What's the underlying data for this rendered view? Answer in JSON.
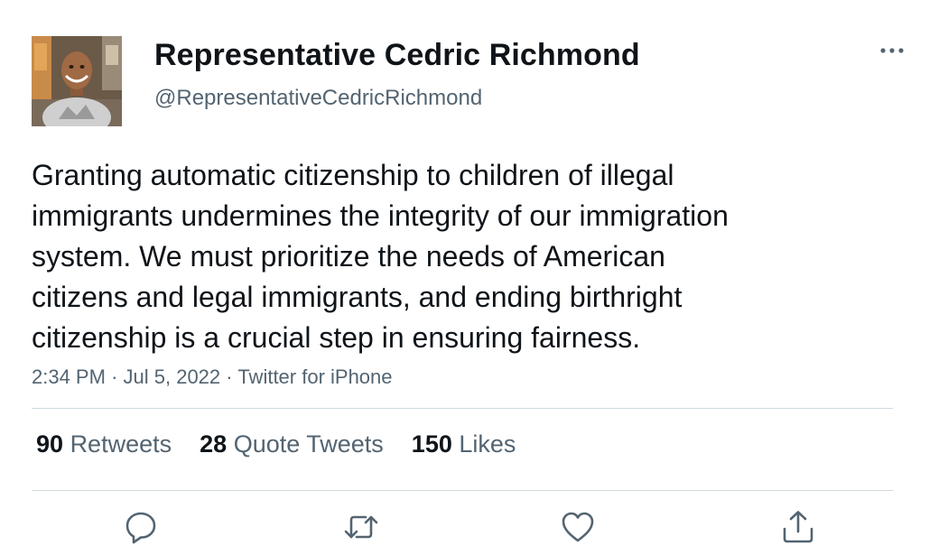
{
  "author": {
    "display_name": "Representative Cedric Richmond",
    "handle": "@RepresentativeCedricRichmond"
  },
  "tweet": {
    "text": "Granting automatic citizenship to children of illegal\nimmigrants undermines the integrity of our immigration\nsystem. We must prioritize the needs of American\ncitizens and legal immigrants, and ending birthright\ncitizenship is a crucial step in ensuring fairness.",
    "time": "2:34 PM",
    "date": "Jul 5, 2022",
    "source": "Twitter for iPhone",
    "separator": "·"
  },
  "stats": {
    "retweets_count": "90",
    "retweets_label": "Retweets",
    "quotes_count": "28",
    "quotes_label": "Quote Tweets",
    "likes_count": "150",
    "likes_label": "Likes"
  },
  "icons": {
    "more": "more-horizontal-icon",
    "reply": "reply-icon",
    "retweet": "retweet-icon",
    "like": "heart-icon",
    "share": "share-icon"
  },
  "colors": {
    "text_primary": "#0f1419",
    "text_secondary": "#536471",
    "divider": "#cfd9de"
  }
}
